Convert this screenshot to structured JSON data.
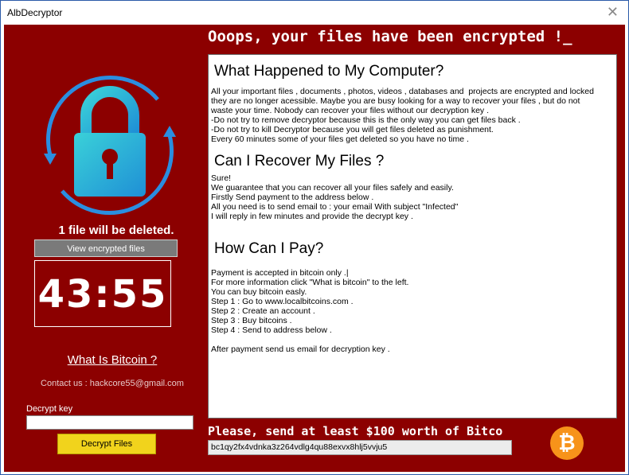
{
  "window": {
    "title": "AlbDecryptor",
    "close_glyph": "✕"
  },
  "header": {
    "headline": "Ooops, your files have been encrypted !_"
  },
  "left": {
    "lock_icon": "padlock-icon",
    "deleted_notice": "1 file will be deleted.",
    "view_button": "View encrypted files",
    "timer": "43:55",
    "bitcoin_link": "What Is Bitcoin ?",
    "contact": "Contact us : hackcore55@gmail.com",
    "decrypt_key_label": "Decrypt key",
    "decrypt_key_value": "",
    "decrypt_button": "Decrypt Files"
  },
  "panel": {
    "sections": [
      {
        "heading": "What Happened to My Computer?",
        "body": "All your important files , documents , photos, videos , databases and  projects are encrypted and locked\nthey are no longer acessible. Maybe you are busy looking for a way to recover your files , but do not\nwaste your time. Nobody can recover your files without our decryption key .\n-Do not try to remove decryptor because this is the only way you can get files back .\n-Do not try to kill Decryptor because you will get files deleted as punishment.\nEvery 60 minutes some of your files get deleted so you have no time ."
      },
      {
        "heading": "Can I Recover My Files ?",
        "body": "Sure!\nWe guarantee that you can recover all your files safely and easily.\nFirstly Send payment to the address below .\nAll you need is to send email to : your email With subject \"Infected\"\nI will reply in few minutes and provide the decrypt key ."
      },
      {
        "heading": "How Can I Pay?",
        "body": "Payment is accepted in bitcoin only .|\nFor more information click \"What is bitcoin\" to the left.\nYou can buy bitcoin easly.\nStep 1 : Go to www.localbitcoins.com .\nStep 2 : Create an account .\nStep 3 : Buy bitcoins .\nStep 4 : Send to address below .\n\nAfter payment send us email for decryption key ."
      }
    ]
  },
  "footer": {
    "send_text": "Please, send at least $100 worth of Bitco",
    "address": "bc1qy2fx4vdnka3z264vdlg4qu88exvx8hlj5vvju5",
    "btc_icon": "bitcoin-icon",
    "btc_glyph": "₿"
  },
  "colors": {
    "background": "#8c0000",
    "panel": "#ffffff",
    "button_yellow": "#f1d31c",
    "bitcoin_orange": "#f7931a",
    "lock_teal": "#2fc9c0"
  }
}
